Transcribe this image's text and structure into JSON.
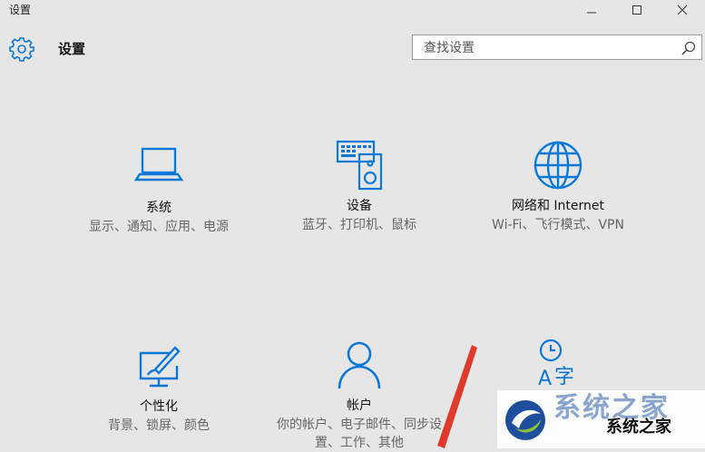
{
  "window": {
    "title": "设置",
    "controls": [
      "minimize-icon",
      "maximize-icon",
      "close-icon"
    ]
  },
  "header": {
    "title": "设置",
    "search_placeholder": "查找设置"
  },
  "tiles": [
    {
      "id": "system",
      "title": "系统",
      "desc": "显示、通知、应用、电源",
      "icon": "laptop-icon"
    },
    {
      "id": "devices",
      "title": "设备",
      "desc": "蓝牙、打印机、鼠标",
      "icon": "devices-icon"
    },
    {
      "id": "network",
      "title": "网络和 Internet",
      "desc": "Wi-Fi、飞行模式、VPN",
      "icon": "globe-icon"
    },
    {
      "id": "personalization",
      "title": "个性化",
      "desc": "背景、锁屏、颜色",
      "icon": "personalization-icon"
    },
    {
      "id": "accounts",
      "title": "帐户",
      "desc": "你的帐户、电子邮件、同步设置、工作、其他",
      "icon": "person-icon"
    },
    {
      "id": "time_language",
      "title": "",
      "desc": "",
      "icon": "time-language-icon"
    }
  ],
  "colors": {
    "accent": "#0a78d7",
    "background": "#e6e6e6",
    "arrow": "#e03a2c"
  },
  "watermark": {
    "text": "系统之家",
    "ghost_text": "系统之家"
  }
}
